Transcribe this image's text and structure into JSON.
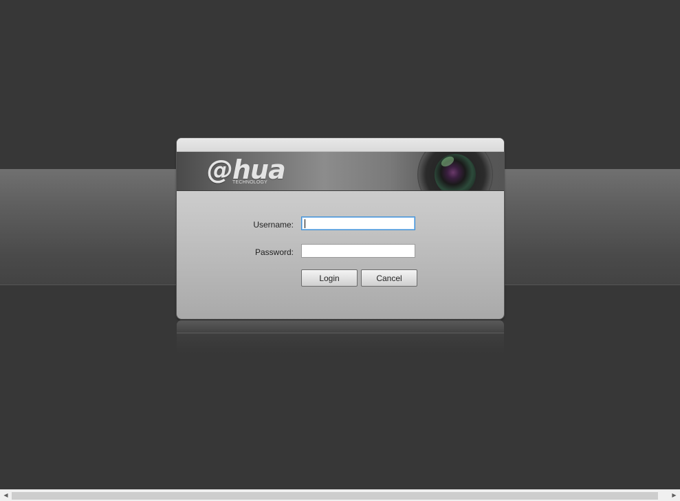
{
  "brand": {
    "logo_text": "alhua",
    "logo_prefix": "a",
    "logo_suffix": "hua",
    "tagline": "TECHNOLOGY"
  },
  "login_form": {
    "username_label": "Username:",
    "username_value": "",
    "password_label": "Password:",
    "password_value": "",
    "login_button": "Login",
    "cancel_button": "Cancel"
  },
  "scrollbar": {
    "left_arrow_icon": "triangle-left-icon",
    "right_arrow_icon": "triangle-right-icon"
  },
  "colors": {
    "background": "#373737",
    "focus_border": "#3a8fd8"
  }
}
